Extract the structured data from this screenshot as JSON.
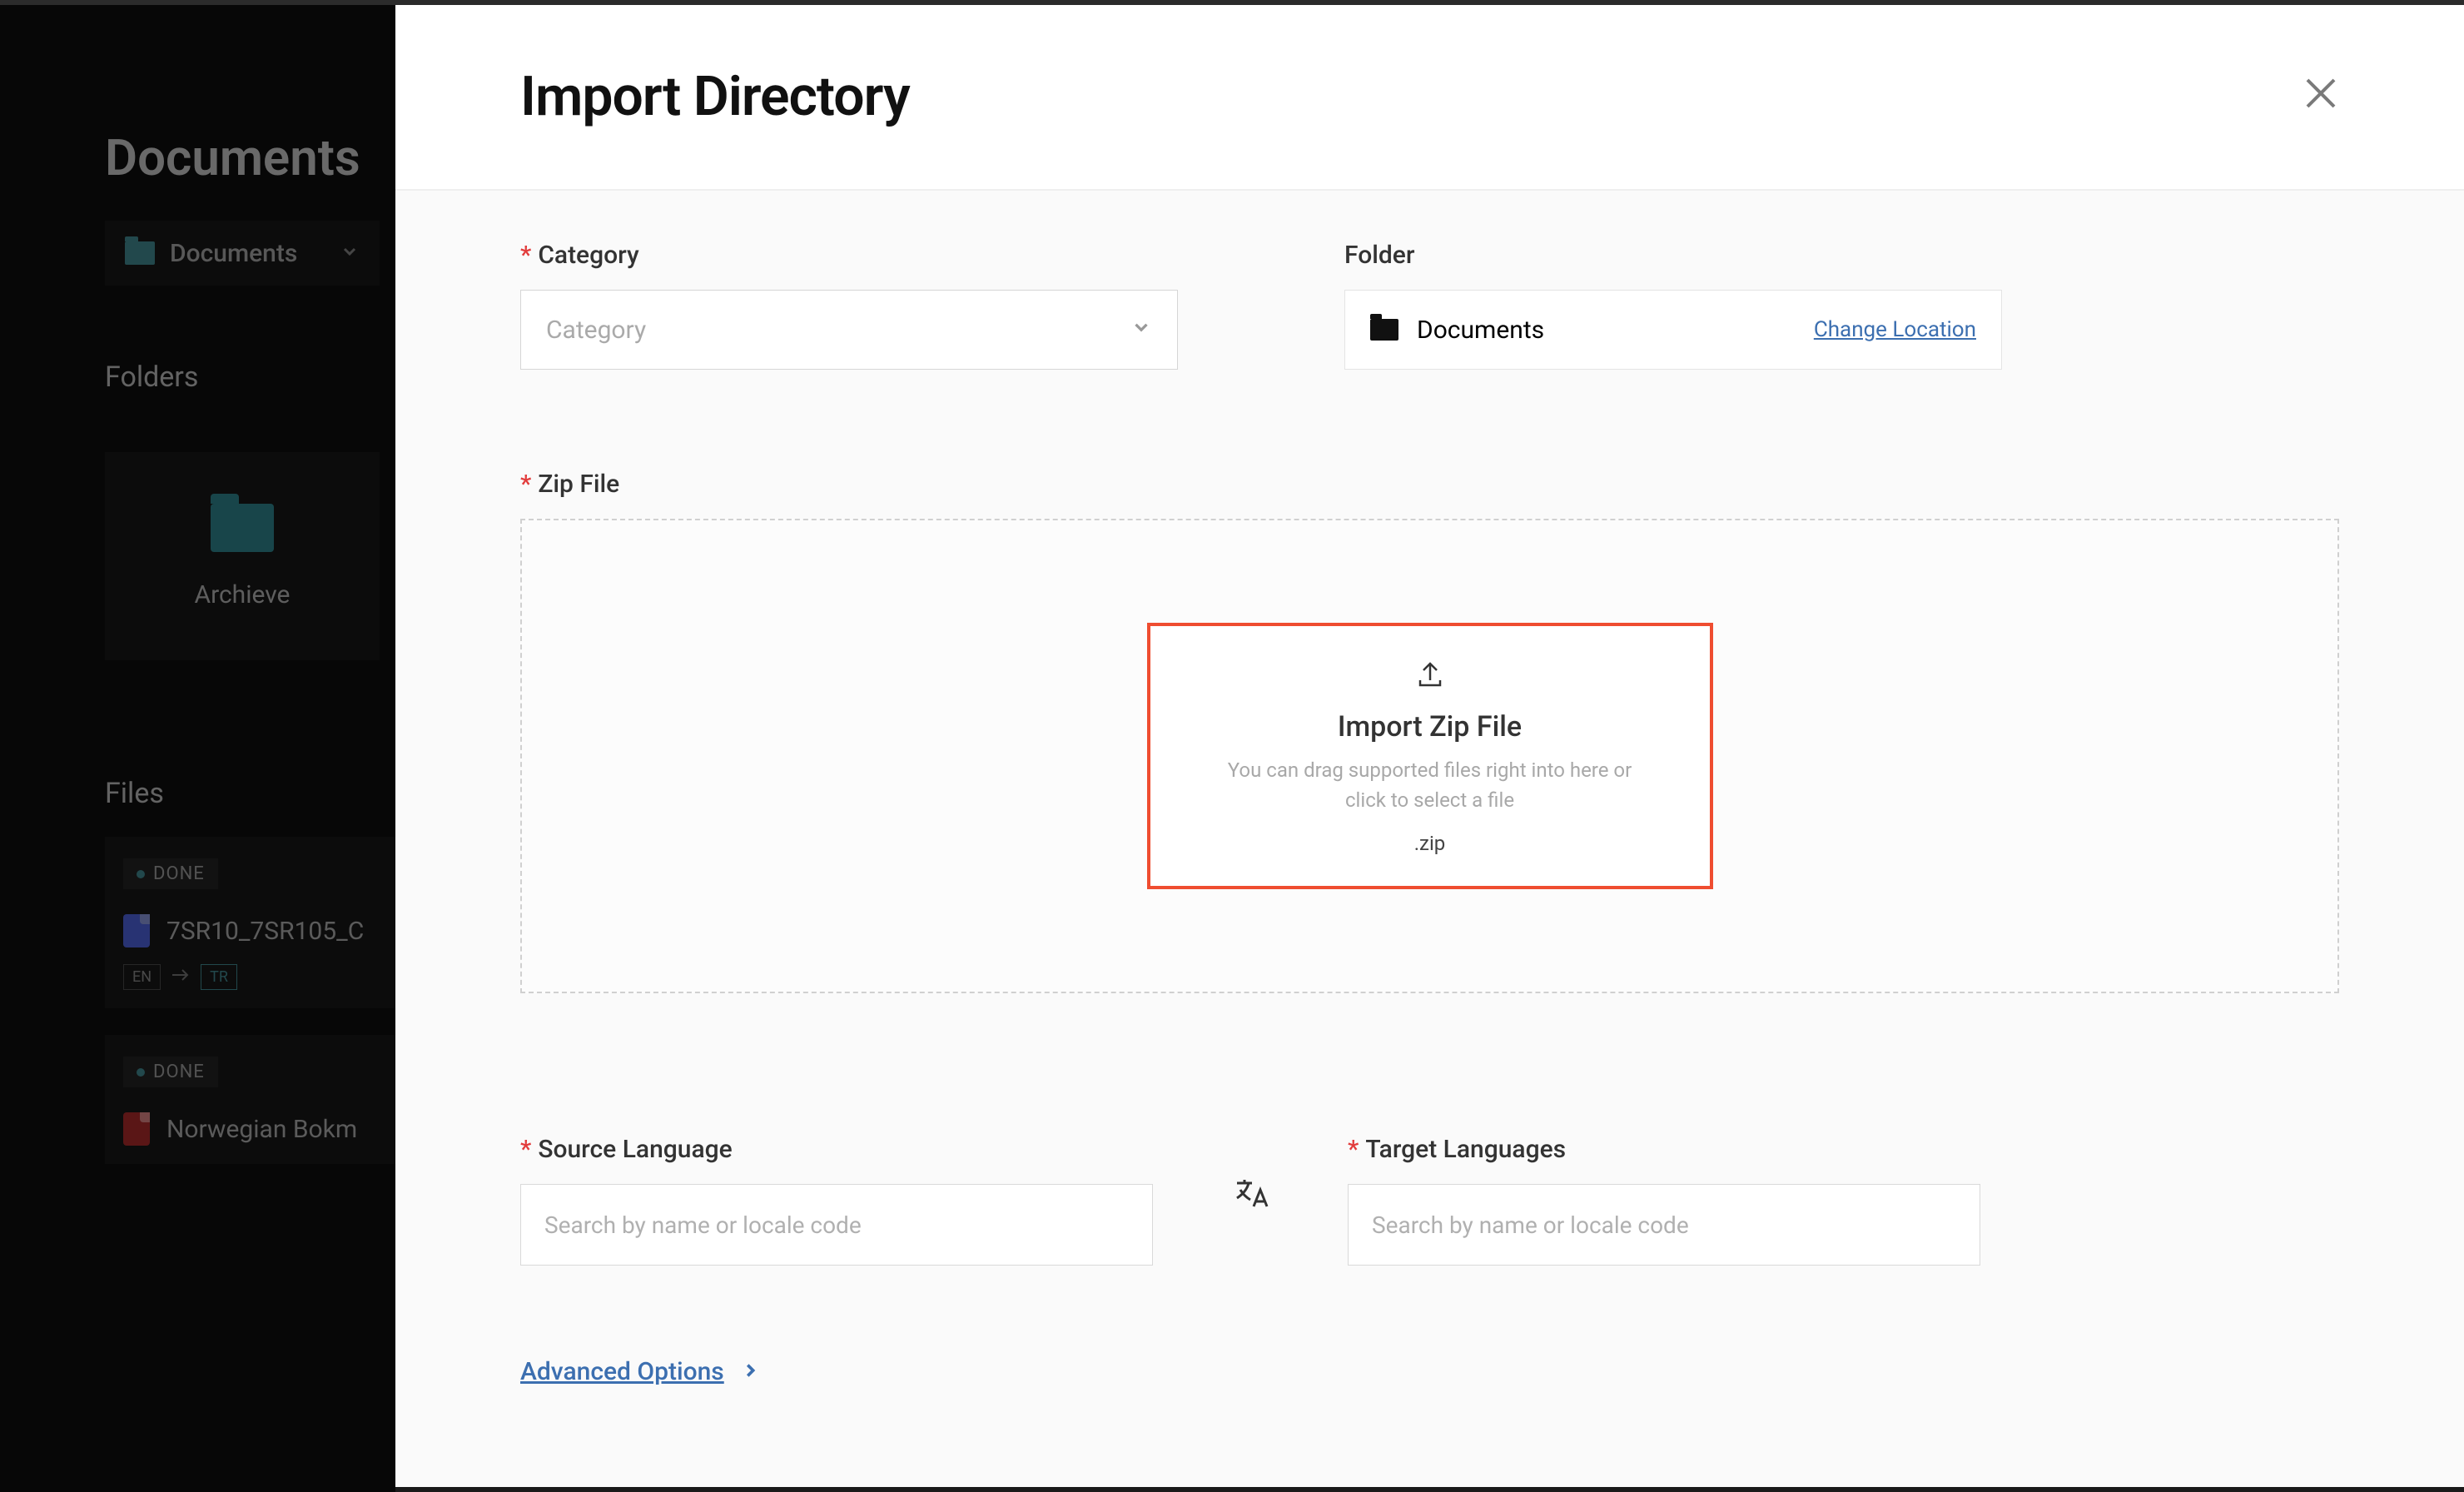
{
  "sidebar": {
    "title": "Documents",
    "breadcrumb_label": "Documents",
    "folders_label": "Folders",
    "folder_card": {
      "label": "Archieve"
    },
    "files_label": "Files",
    "files": [
      {
        "status": "DONE",
        "name": "7SR10_7SR105_C",
        "src_lang": "EN",
        "tgt_lang": "TR",
        "type": "doc"
      },
      {
        "status": "DONE",
        "name": "Norwegian Bokm",
        "type": "pdf"
      }
    ]
  },
  "modal": {
    "title": "Import Directory",
    "category_label": "Category",
    "category_placeholder": "Category",
    "folder_label": "Folder",
    "folder_value": "Documents",
    "change_location": "Change Location",
    "zip_label": "Zip File",
    "drop": {
      "title": "Import Zip File",
      "sub": "You can drag supported files right into here or click to select a file",
      "ext": ".zip"
    },
    "source_lang_label": "Source Language",
    "target_lang_label": "Target Languages",
    "lang_placeholder": "Search by name or locale code",
    "advanced_label": "Advanced Options"
  }
}
